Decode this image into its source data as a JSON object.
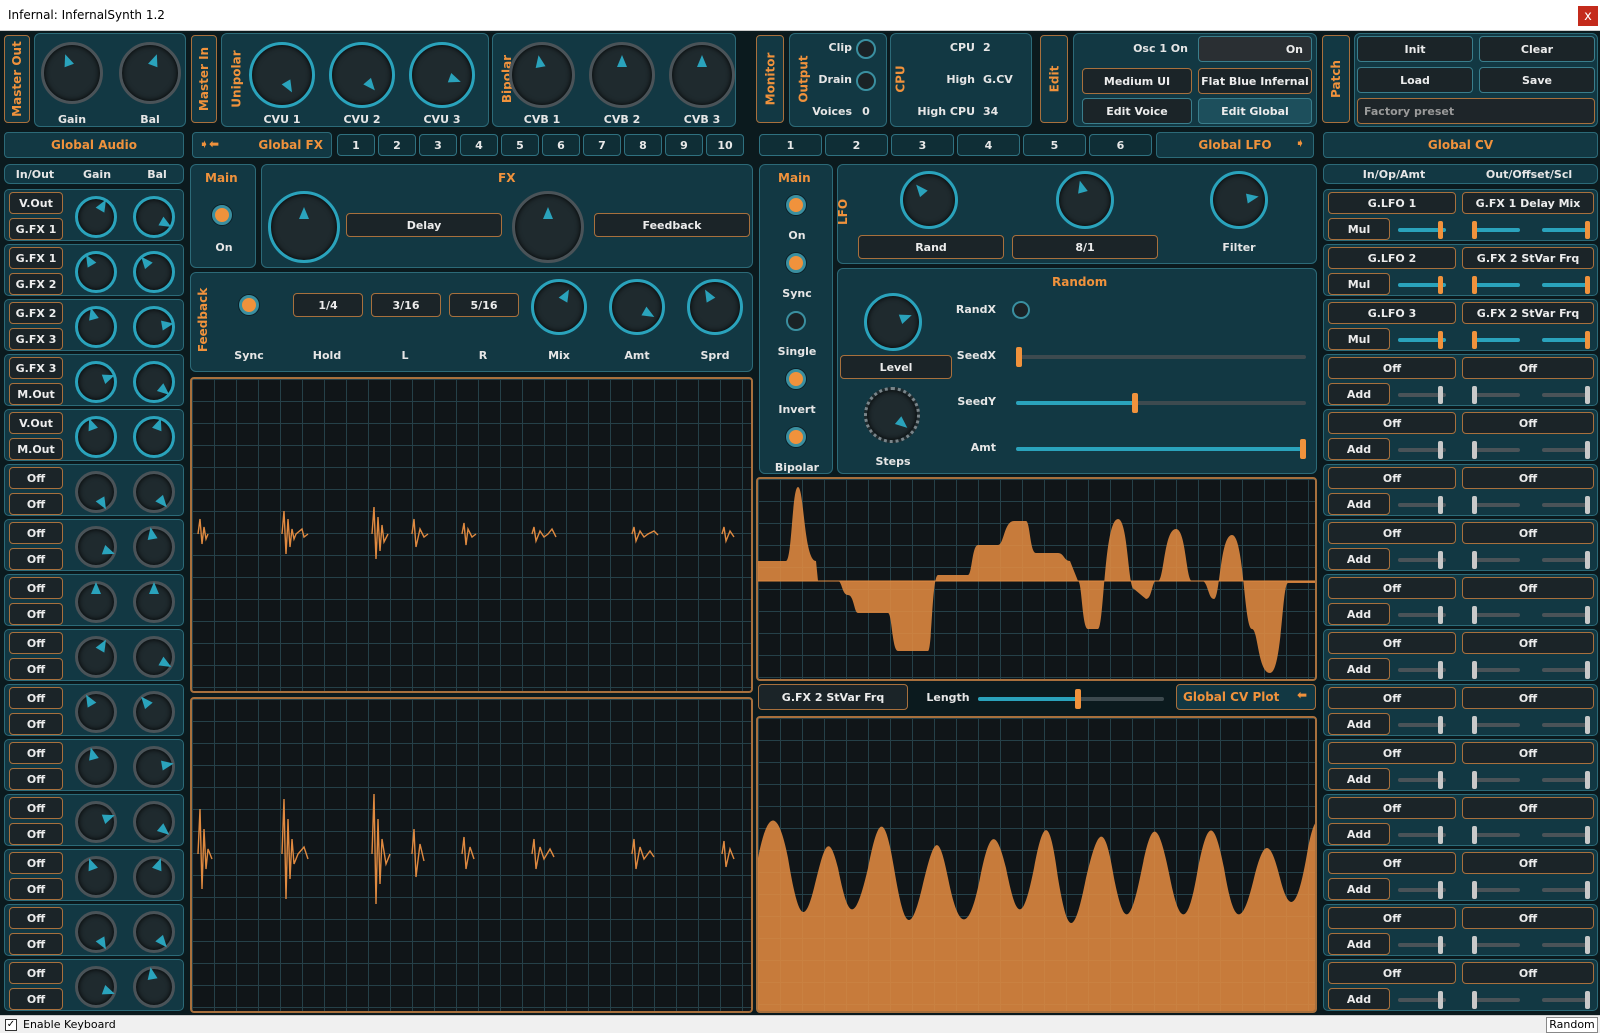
{
  "window": {
    "title": "Infernal: InfernalSynth 1.2",
    "close": "x"
  },
  "top": {
    "master_out": "Master Out",
    "gain": "Gain",
    "bal": "Bal",
    "master_in": "Master In",
    "unipolar": "Unipolar",
    "cvu": [
      "CVU 1",
      "CVU 2",
      "CVU 3"
    ],
    "bipolar": "Bipolar",
    "cvb": [
      "CVB 1",
      "CVB 2",
      "CVB 3"
    ],
    "monitor": "Monitor",
    "output": "Output",
    "clip": "Clip",
    "drain": "Drain",
    "voices": "Voices",
    "voices_val": "0",
    "cpu_tab": "CPU",
    "cpu": [
      [
        "CPU",
        "2"
      ],
      [
        "High",
        "G.CV"
      ],
      [
        "High CPU",
        "34"
      ]
    ],
    "edit": "Edit",
    "osc_label": "Osc 1 On",
    "osc_value": "On",
    "medium_ui": "Medium UI",
    "theme": "Flat Blue Infernal",
    "edit_voice": "Edit Voice",
    "edit_global": "Edit Global",
    "patch": "Patch",
    "init": "Init",
    "clear": "Clear",
    "load": "Load",
    "save": "Save",
    "preset_placeholder": "Factory preset"
  },
  "tabs": {
    "global_audio": "Global Audio",
    "global_fx": "Global FX",
    "fx_nums": [
      "1",
      "2",
      "3",
      "4",
      "5",
      "6",
      "7",
      "8",
      "9",
      "10"
    ],
    "lfo_nums": [
      "1",
      "2",
      "3",
      "4",
      "5",
      "6"
    ],
    "global_lfo": "Global LFO",
    "global_cv": "Global CV"
  },
  "audio": {
    "headers": [
      "In/Out",
      "Gain",
      "Bal"
    ],
    "rows": [
      [
        "V.Out",
        "G.FX 1"
      ],
      [
        "G.FX 1",
        "G.FX 2"
      ],
      [
        "G.FX 2",
        "G.FX 3"
      ],
      [
        "G.FX 3",
        "M.Out"
      ],
      [
        "V.Out",
        "M.Out"
      ],
      [
        "Off",
        "Off"
      ],
      [
        "Off",
        "Off"
      ],
      [
        "Off",
        "Off"
      ],
      [
        "Off",
        "Off"
      ],
      [
        "Off",
        "Off"
      ],
      [
        "Off",
        "Off"
      ],
      [
        "Off",
        "Off"
      ],
      [
        "Off",
        "Off"
      ],
      [
        "Off",
        "Off"
      ],
      [
        "Off",
        "Off"
      ]
    ]
  },
  "fx": {
    "main": "Main",
    "on": "On",
    "fx": "FX",
    "delay": "Delay",
    "feedback": "Feedback",
    "fb_label": "Feedback",
    "sync": "Sync",
    "hold": "Hold",
    "l": "L",
    "r": "R",
    "mix": "Mix",
    "amt": "Amt",
    "sprd": "Sprd",
    "hold_val": "1/4",
    "l_val": "3/16",
    "r_val": "5/16"
  },
  "lfo": {
    "main": "Main",
    "on": "On",
    "sync": "Sync",
    "single": "Single",
    "invert": "Invert",
    "bipolar": "Bipolar",
    "lfo": "LFO",
    "rand": "Rand",
    "rate": "8/1",
    "filter": "Filter",
    "random": "Random",
    "randx": "RandX",
    "seedx": "SeedX",
    "seedy": "SeedY",
    "amt": "Amt",
    "level": "Level",
    "steps": "Steps",
    "seedx_val": 0,
    "seedy_val": 0.41,
    "amt_val": 1.0
  },
  "plot": {
    "target": "G.FX 2 StVar Frq",
    "length": "Length",
    "length_val": 0.54,
    "title": "Global CV Plot"
  },
  "cv": {
    "headers": [
      "In/Op/Amt",
      "Out/Offset/Scl"
    ],
    "rows": [
      [
        "G.LFO 1",
        "G.FX 1 Delay Mix",
        "Mul"
      ],
      [
        "G.LFO 2",
        "G.FX 2 StVar Frq",
        "Mul"
      ],
      [
        "G.LFO 3",
        "G.FX 2 StVar Frq",
        "Mul"
      ],
      [
        "Off",
        "Off",
        "Add"
      ],
      [
        "Off",
        "Off",
        "Add"
      ],
      [
        "Off",
        "Off",
        "Add"
      ],
      [
        "Off",
        "Off",
        "Add"
      ],
      [
        "Off",
        "Off",
        "Add"
      ],
      [
        "Off",
        "Off",
        "Add"
      ],
      [
        "Off",
        "Off",
        "Add"
      ],
      [
        "Off",
        "Off",
        "Add"
      ],
      [
        "Off",
        "Off",
        "Add"
      ],
      [
        "Off",
        "Off",
        "Add"
      ],
      [
        "Off",
        "Off",
        "Add"
      ],
      [
        "Off",
        "Off",
        "Add"
      ]
    ]
  },
  "status": {
    "keyboard": "Enable Keyboard",
    "random": "Random"
  }
}
